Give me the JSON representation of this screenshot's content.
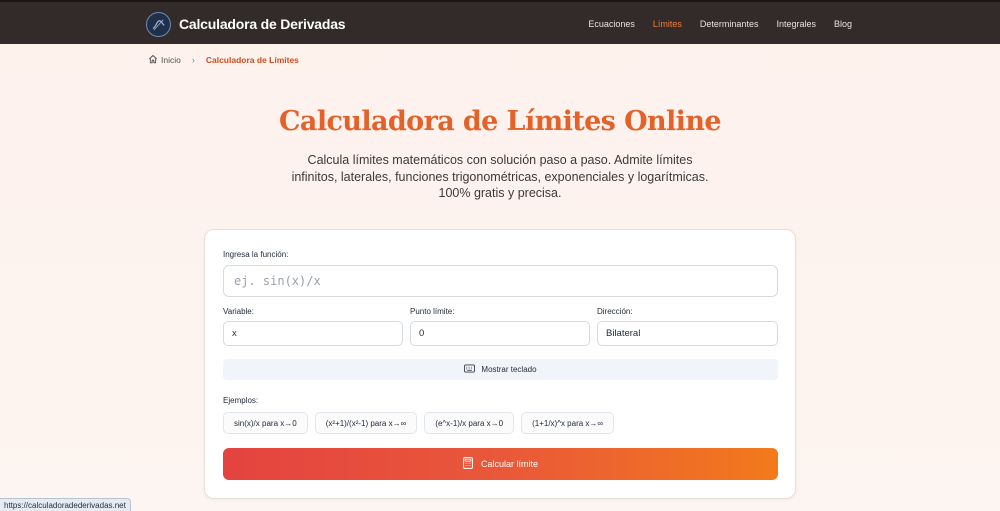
{
  "header": {
    "brand": "Calculadora de Derivadas",
    "nav": [
      {
        "label": "Ecuaciones",
        "active": false
      },
      {
        "label": "Límites",
        "active": true
      },
      {
        "label": "Determinantes",
        "active": false
      },
      {
        "label": "Integrales",
        "active": false
      },
      {
        "label": "Blog",
        "active": false
      }
    ]
  },
  "breadcrumb": {
    "home": "Inicio",
    "current": "Calculadora de Límites"
  },
  "hero": {
    "title": "Calculadora de Límites Online",
    "description": "Calcula límites matemáticos con solución paso a paso. Admite límites infinitos, laterales, funciones trigonométricas, exponenciales y logarítmicas. 100% gratis y precisa."
  },
  "form": {
    "function_label": "Ingresa la función:",
    "function_placeholder": "ej. sin(x)/x",
    "function_value": "",
    "variable_label": "Variable:",
    "variable_value": "x",
    "point_label": "Punto límite:",
    "point_value": "0",
    "direction_label": "Dirección:",
    "direction_value": "Bilateral",
    "keyboard_button": "Mostrar teclado",
    "examples_label": "Ejemplos:",
    "examples": [
      "sin(x)/x para x→0",
      "(x²+1)/(x²-1) para x→∞",
      "(e^x-1)/x para x→0",
      "(1+1/x)^x para x→∞"
    ],
    "calculate_button": "Calcular límite"
  },
  "status_url": "https://calculadoradederivadas.net",
  "colors": {
    "header_bg": "#332b2a",
    "accent": "#e4622a",
    "active_nav": "#f27c3a",
    "button_gradient_start": "#e4433f",
    "button_gradient_end": "#f27a1b"
  },
  "icons": {
    "brand": "logo-icon",
    "home": "home-icon",
    "separator": "chevron-right-icon",
    "keyboard": "keyboard-icon",
    "calculate": "calculator-icon"
  }
}
